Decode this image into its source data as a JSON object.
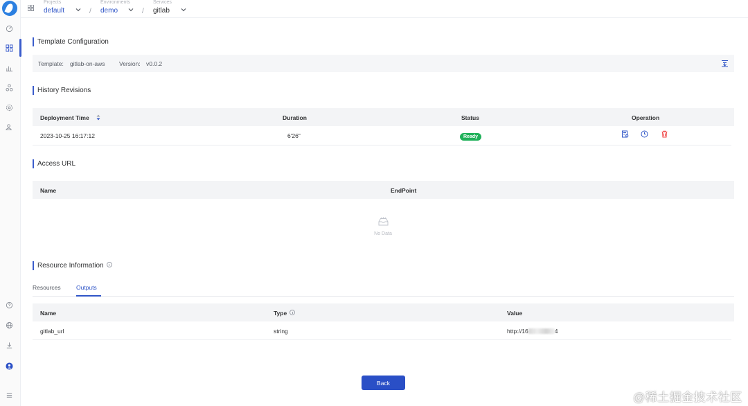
{
  "breadcrumb": {
    "projects_label": "Projects",
    "project": "default",
    "environments_label": "Environments",
    "environment": "demo",
    "services_label": "Services",
    "service": "gitlab",
    "separator": "/"
  },
  "sidebar": {
    "icons": [
      "dashboard-icon",
      "apps-icon",
      "chart-icon",
      "cluster-icon",
      "settings-icon",
      "users-icon",
      "help-icon",
      "globe-icon",
      "download-icon",
      "user-avatar-icon",
      "menu-icon"
    ],
    "active_index": 1,
    "accent": "#3a5ccc"
  },
  "template_config": {
    "title": "Template Configuration",
    "template_label": "Template:",
    "template_value": "gitlab-on-aws",
    "version_label": "Version:",
    "version_value": "v0.0.2"
  },
  "history": {
    "title": "History Revisions",
    "columns": [
      "Deployment Time",
      "Duration",
      "Status",
      "Operation"
    ],
    "rows": [
      {
        "time": "2023-10-25 16:17:12",
        "duration": "6'26\"",
        "status": "Ready"
      }
    ],
    "status_color": "#20b15a",
    "operation_icons": [
      "detail-icon",
      "history-icon",
      "delete-icon"
    ]
  },
  "access_url": {
    "title": "Access URL",
    "columns": [
      "Name",
      "EndPoint"
    ],
    "empty_text": "No Data"
  },
  "resource_info": {
    "title": "Resource Information",
    "tabs": [
      "Resources",
      "Outputs"
    ],
    "active_tab": "Outputs",
    "columns": [
      "Name",
      "Type",
      "Value"
    ],
    "rows": [
      {
        "name": "gitlab_url",
        "type": "string",
        "value_prefix": "http://16",
        "value_suffix": "4"
      }
    ]
  },
  "back_label": "Back",
  "watermark": "@稀土掘金技术社区",
  "colors": {
    "primary": "#2a4fc6",
    "link": "#2f55c7",
    "danger": "#f04545"
  }
}
